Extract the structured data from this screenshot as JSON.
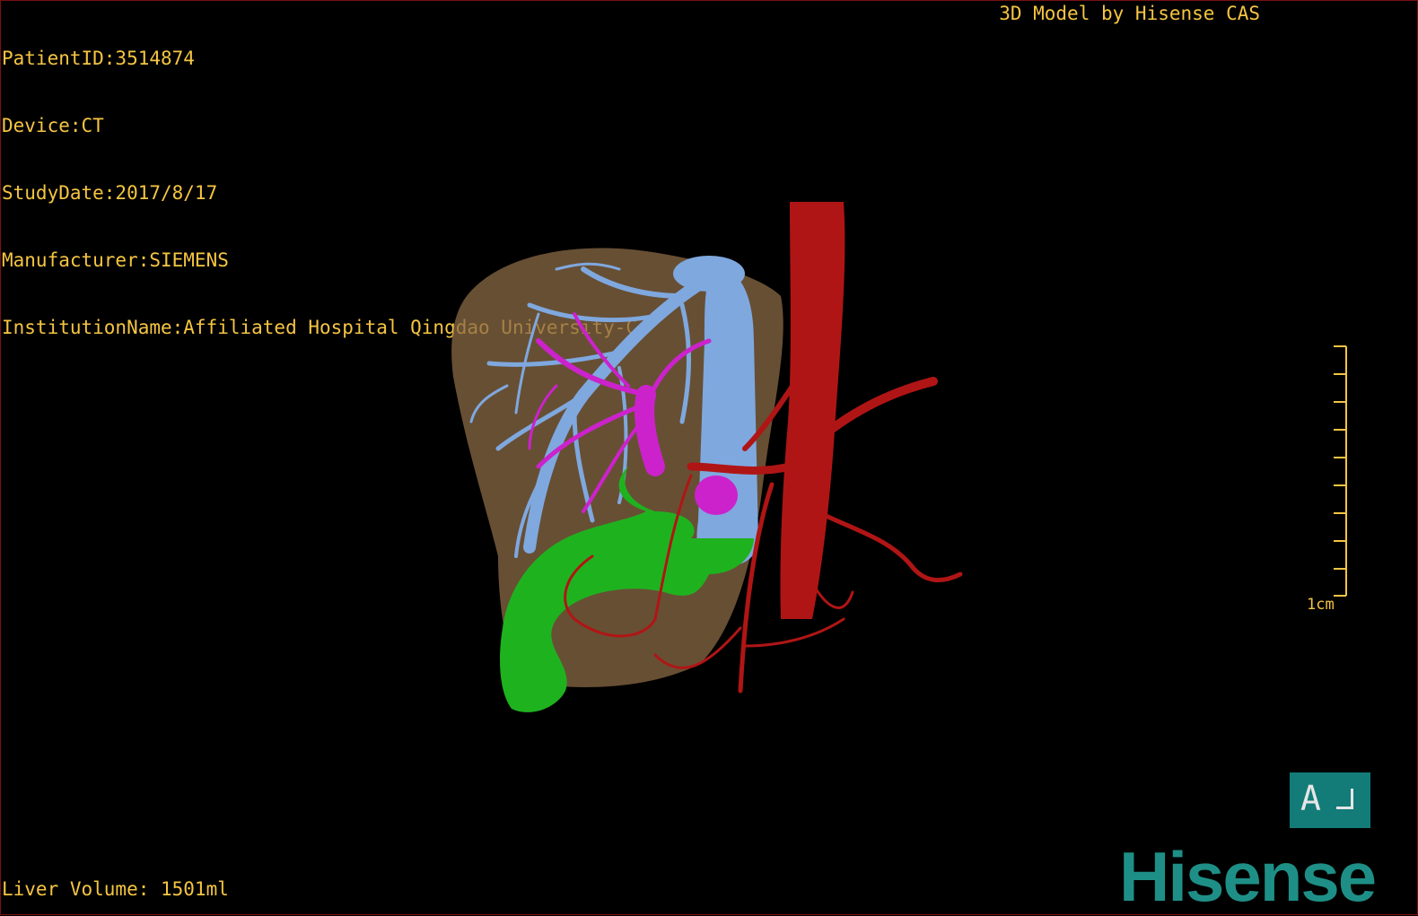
{
  "overlay": {
    "patient_id": "PatientID:3514874",
    "device": "Device:CT",
    "study_date": "StudyDate:2017/8/17",
    "manufacturer": "Manufacturer:SIEMENS",
    "institution": "InstitutionName:Affiliated Hospital Qingdao University-C",
    "model_by": "3D Model by Hisense CAS",
    "liver_volume": "Liver Volume: 1501ml"
  },
  "scale_bar": {
    "label": "1cm"
  },
  "orientation": {
    "label": "A"
  },
  "logo": {
    "text": "Hisense"
  },
  "colors": {
    "text": "#f5c542",
    "liver": "#8a6a45",
    "hepatic_veins": "#7fa8df",
    "portal_vein": "#cc22cc",
    "gallbladder": "#1fb21f",
    "artery": "#b01515",
    "orientation_bg": "#137c79",
    "logo": "#1e8f86"
  }
}
